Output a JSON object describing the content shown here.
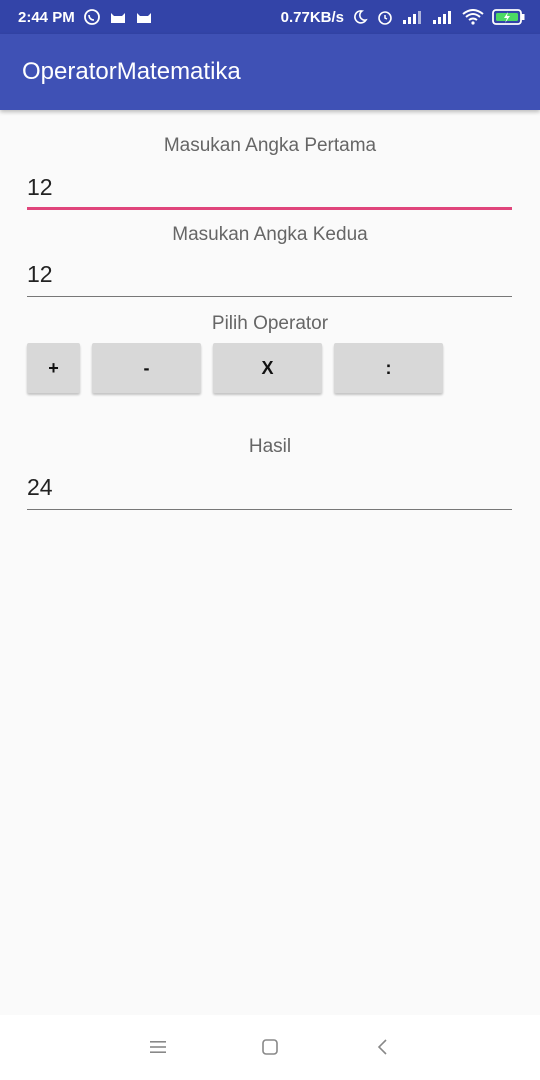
{
  "status_bar": {
    "time": "2:44 PM",
    "net_speed": "0.77KB/s"
  },
  "app_bar": {
    "title": "OperatorMatematika"
  },
  "form": {
    "first_label": "Masukan Angka Pertama",
    "first_value": "12",
    "second_label": "Masukan Angka Kedua",
    "second_value": "12",
    "operator_label": "Pilih Operator",
    "operators": [
      "+",
      "-",
      "X",
      ":"
    ],
    "result_label": "Hasil",
    "result_value": "24"
  },
  "colors": {
    "status_bar": "#3344a8",
    "app_bar": "#3f51b5",
    "focus_accent": "#e0457b"
  },
  "icons": [
    "whatsapp-icon",
    "cat-icon",
    "moon-icon",
    "alarm-icon",
    "signal-icon",
    "wifi-icon",
    "battery-icon",
    "menu-icon",
    "home-icon",
    "back-icon"
  ]
}
